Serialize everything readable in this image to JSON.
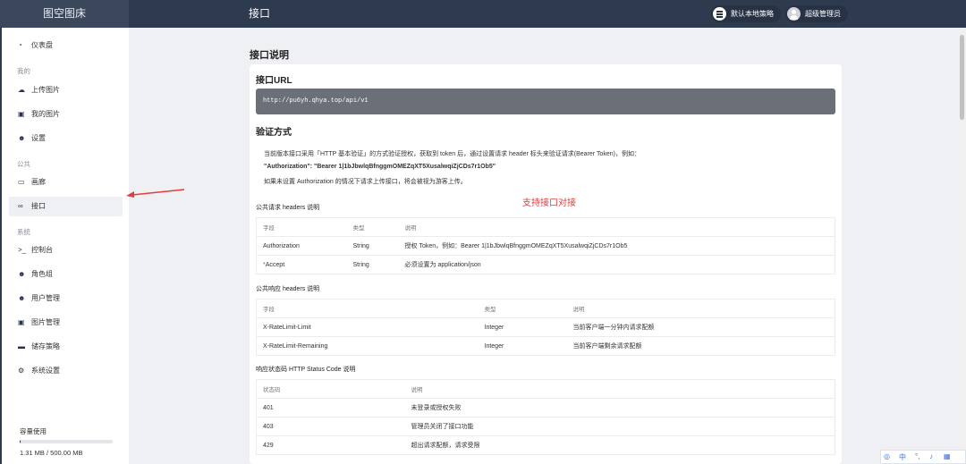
{
  "app": {
    "brand": "图空图床",
    "title": "接口"
  },
  "header": {
    "strategy_label": "默认本地策略",
    "user_label": "超级管理员"
  },
  "sidebar": {
    "items": [
      {
        "label": "仪表盘",
        "icon": "dashboard-icon",
        "active": false
      },
      {
        "section": "我的"
      },
      {
        "label": "上传图片",
        "icon": "cloud-upload-icon",
        "active": false
      },
      {
        "label": "我的图片",
        "icon": "images-icon",
        "active": false
      },
      {
        "label": "设置",
        "icon": "user-cog-icon",
        "active": false
      },
      {
        "section": "公共"
      },
      {
        "label": "画廊",
        "icon": "gallery-icon",
        "active": false
      },
      {
        "label": "接口",
        "icon": "link-icon",
        "active": true
      },
      {
        "section": "系统"
      },
      {
        "label": "控制台",
        "icon": "terminal-icon",
        "active": false
      },
      {
        "label": "角色组",
        "icon": "users-icon",
        "active": false
      },
      {
        "label": "用户管理",
        "icon": "users-cog-icon",
        "active": false
      },
      {
        "label": "图片管理",
        "icon": "images-icon",
        "active": false
      },
      {
        "label": "储存策略",
        "icon": "hdd-icon",
        "active": false
      },
      {
        "label": "系统设置",
        "icon": "cogs-icon",
        "active": false
      }
    ],
    "capacity": {
      "label": "容量使用",
      "value": "1.31 MB / 500.00 MB",
      "fraction": 0.0026
    }
  },
  "main": {
    "page_title": "接口说明",
    "url_heading": "接口URL",
    "url": "http://pu6yh.qhya.top/api/v1",
    "auth_heading": "验证方式",
    "auth_p1": "当前版本接口采用「HTTP 基本验证」的方式验证授权，获取到 token 后，通过设置请求 header 标头来验证请求(Bearer Token)，例如：",
    "auth_example": "\"Authorization\": \"Bearer 1|1bJbwlqBfnggmOMEZqXT5XusalwqiZjCDs7r1Ob5\"",
    "auth_p2": "如果未设置 Authorization 的情况下请求上传接口，将会被视为游客上传。",
    "annotation": "支持接口对接",
    "req_headers": {
      "title": "公共请求 headers 说明",
      "columns": [
        "字段",
        "类型",
        "说明"
      ],
      "rows": [
        {
          "field": "Authorization",
          "type": "String",
          "desc": "授权 Token，例如：Bearer 1|1bJbwlqBfnggmOMEZqXT5XusalwqiZjCDs7r1Ob5",
          "required": false
        },
        {
          "field": "Accept",
          "type": "String",
          "desc": "必须设置为 application/json",
          "required": true
        }
      ]
    },
    "resp_headers": {
      "title": "公共响应 headers 说明",
      "columns": [
        "字段",
        "类型",
        "说明"
      ],
      "rows": [
        {
          "field": "X-RateLimit-Limit",
          "type": "Integer",
          "desc": "当前客户端一分钟内请求配额"
        },
        {
          "field": "X-RateLimit-Remaining",
          "type": "Integer",
          "desc": "当前客户端剩余请求配额"
        }
      ]
    },
    "status_codes": {
      "title": "响应状态码 HTTP Status Code 说明",
      "columns": [
        "状态码",
        "说明"
      ],
      "rows": [
        {
          "code": "401",
          "desc": "未登录或授权失败"
        },
        {
          "code": "403",
          "desc": "管理员关闭了接口功能"
        },
        {
          "code": "429",
          "desc": "超出请求配额，请求受限"
        }
      ]
    }
  },
  "ime": {
    "items": [
      "中"
    ]
  }
}
